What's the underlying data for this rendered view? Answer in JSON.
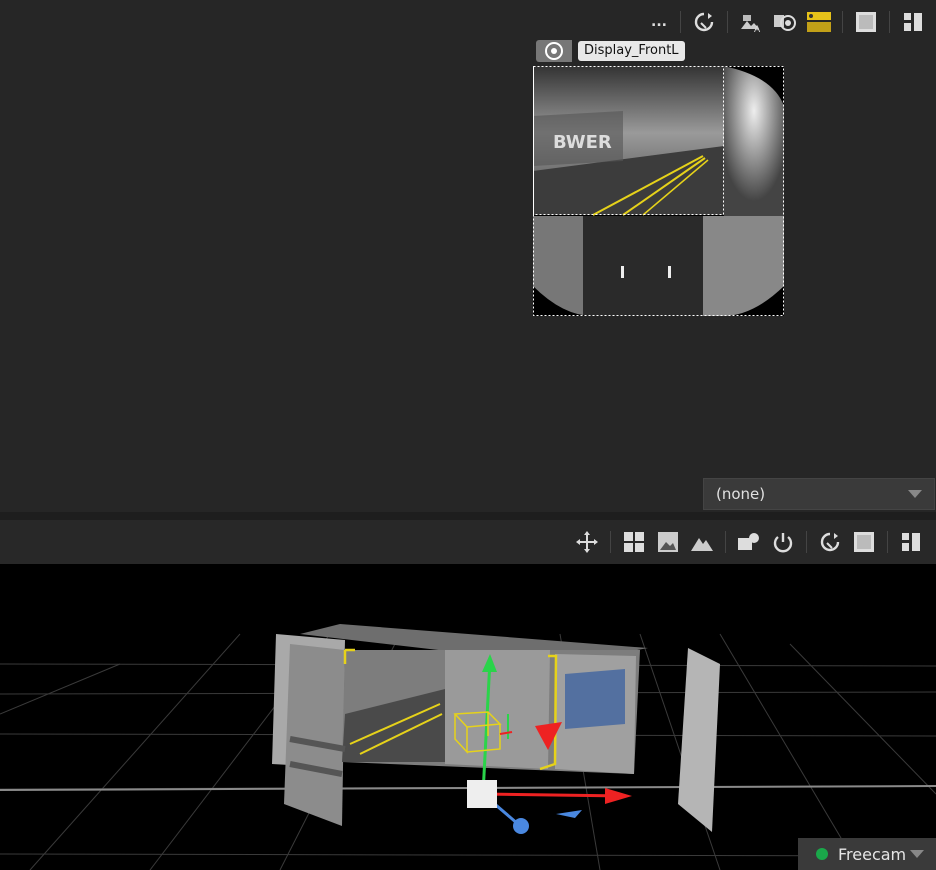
{
  "top_toolbar": {
    "more_label": "...",
    "icons": [
      "refresh-icon",
      "text-overlay-icon",
      "camera-target-icon",
      "layers-icon",
      "frame-icon",
      "layout-icon"
    ]
  },
  "display": {
    "tab_label": "Display_FrontL"
  },
  "dropdown": {
    "value": "(none)"
  },
  "viewport_toolbar": {
    "icons": [
      "move-gizmo-icon",
      "grid-icon",
      "image-icon",
      "terrain-icon",
      "camera-light-icon",
      "power-icon",
      "refresh-icon",
      "frame-icon",
      "layout-icon"
    ]
  },
  "freecam": {
    "label": "Freecam",
    "status_color": "#1aa84a"
  },
  "colors": {
    "panel_bg": "#262626",
    "viewport_bg": "#000000",
    "accent_yellow": "#e6d21a"
  }
}
